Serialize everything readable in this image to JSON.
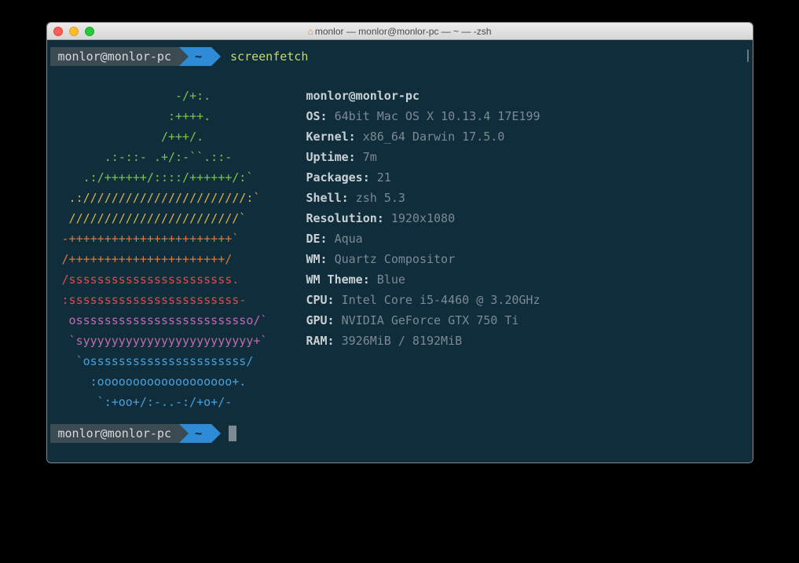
{
  "window": {
    "title": "monlor — monlor@monlor-pc — ~ — -zsh"
  },
  "prompt": {
    "user_host": "monlor@monlor-pc",
    "dir": "~",
    "command": "screenfetch"
  },
  "ascii": {
    "l1": "                 -/+:.         ",
    "l2": "                :++++.         ",
    "l3": "               /+++/.          ",
    "l4": "       .:-::- .+/:-``.::-      ",
    "l5": "    .:/++++++/::::/++++++/:`   ",
    "l6": "  .:///////////////////////:`  ",
    "l7": "  ////////////////////////`    ",
    "l8": " -+++++++++++++++++++++++`     ",
    "l9": " /++++++++++++++++++++++/      ",
    "l10": " /sssssssssssssssssssssss.     ",
    "l11": " :ssssssssssssssssssssssss-    ",
    "l12": "  osssssssssssssssssssssssso/` ",
    "l13": "  `syyyyyyyyyyyyyyyyyyyyyyyy+` ",
    "l14": "   `ossssssssssssssssssssss/   ",
    "l15": "     :ooooooooooooooooooo+.    ",
    "l16": "      `:+oo+/:-..-:/+o+/-      "
  },
  "info": {
    "header": "monlor@monlor-pc",
    "os_label": "OS:",
    "os_value": "64bit Mac OS X 10.13.4 17E199",
    "kernel_label": "Kernel:",
    "kernel_value": "x86_64 Darwin 17.5.0",
    "uptime_label": "Uptime:",
    "uptime_value": "7m",
    "packages_label": "Packages:",
    "packages_value": "21",
    "shell_label": "Shell:",
    "shell_value": "zsh 5.3",
    "resolution_label": "Resolution:",
    "resolution_value": "1920x1080",
    "de_label": "DE:",
    "de_value": "Aqua",
    "wm_label": "WM:",
    "wm_value": "Quartz Compositor",
    "wmtheme_label": "WM Theme:",
    "wmtheme_value": "Blue",
    "cpu_label": "CPU:",
    "cpu_value": "Intel Core i5-4460 @ 3.20GHz",
    "gpu_label": "GPU:",
    "gpu_value": "NVIDIA GeForce GTX 750 Ti",
    "ram_label": "RAM:",
    "ram_value": "3926MiB / 8192MiB"
  }
}
